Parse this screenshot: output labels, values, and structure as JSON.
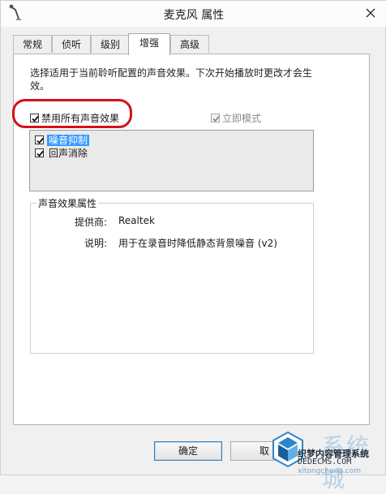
{
  "window": {
    "title": "麦克风 属性"
  },
  "tabs": [
    {
      "label": "常规"
    },
    {
      "label": "侦听"
    },
    {
      "label": "级别"
    },
    {
      "label": "增强"
    },
    {
      "label": "高级"
    }
  ],
  "enhancements": {
    "description": "选择适用于当前聆听配置的声音效果。下次开始播放时更改才会生效。",
    "disable_all": {
      "label": "禁用所有声音效果",
      "checked": true
    },
    "immediate_mode": {
      "label": "立即模式",
      "checked": true,
      "enabled": false
    },
    "effects": [
      {
        "label": "噪音抑制",
        "checked": true,
        "selected": true
      },
      {
        "label": "回声消除",
        "checked": true,
        "selected": false
      }
    ]
  },
  "properties": {
    "group_title": "声音效果属性",
    "provider_label": "提供商:",
    "provider_value": "Realtek",
    "description_label": "说明:",
    "description_value": "用于在录音时降低静态背景噪音 (v2)"
  },
  "buttons": {
    "ok": "确定",
    "cancel": "取"
  },
  "watermark": {
    "brand_cn": "系统城",
    "line1": "织梦内容管理系统",
    "line2": "DEDECMS.COM",
    "line3": "xitongcheng.com"
  },
  "colors": {
    "highlight_ring": "#d4111a",
    "selection": "#3399ff"
  }
}
